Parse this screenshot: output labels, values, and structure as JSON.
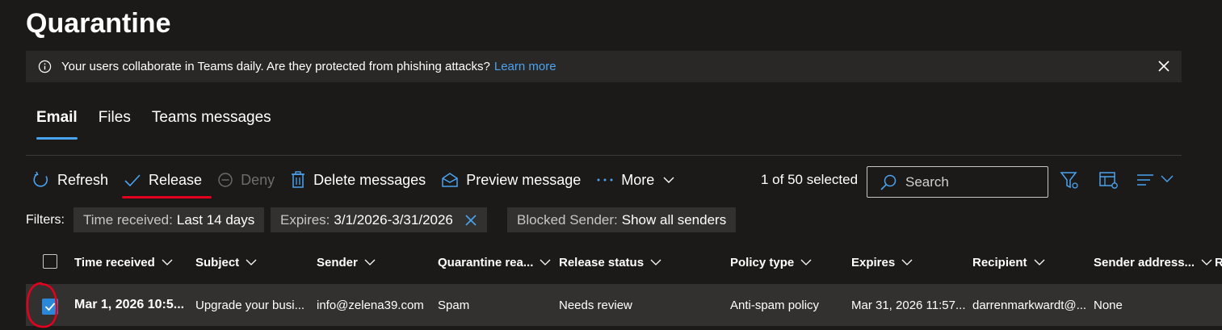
{
  "page": {
    "title": "Quarantine"
  },
  "banner": {
    "text": "Your users collaborate in Teams daily. Are they protected from phishing attacks?",
    "link": "Learn more",
    "icon": "info-icon",
    "close_icon": "close-icon"
  },
  "tabs": [
    {
      "label": "Email",
      "active": true
    },
    {
      "label": "Files",
      "active": false
    },
    {
      "label": "Teams messages",
      "active": false
    }
  ],
  "toolbar": {
    "refresh": "Refresh",
    "release": "Release",
    "deny": "Deny",
    "delete": "Delete messages",
    "preview": "Preview message",
    "more": "More",
    "selected_count": "1 of 50 selected",
    "search_placeholder": "Search"
  },
  "filters": {
    "label": "Filters:",
    "chips": [
      {
        "key": "Time received:",
        "value": "Last 14 days"
      },
      {
        "key": "Expires:",
        "value": "3/1/2026-3/31/2026"
      },
      {
        "key": "Blocked Sender:",
        "value": "Show all senders"
      }
    ]
  },
  "table": {
    "columns": [
      "Time received",
      "Subject",
      "Sender",
      "Quarantine rea...",
      "Release status",
      "Policy type",
      "Expires",
      "Recipient",
      "Sender address...",
      "R"
    ],
    "rows": [
      {
        "selected": true,
        "time_received": "Mar 1, 2026 10:5...",
        "subject": "Upgrade your busi...",
        "sender": "info@zelena39.com",
        "quarantine_reason": "Spam",
        "release_status": "Needs review",
        "policy_type": "Anti-spam policy",
        "expires": "Mar 31, 2026 11:57...",
        "recipient": "darrenmarkwardt@...",
        "sender_address": "None"
      }
    ]
  },
  "colors": {
    "background": "#1b1a19",
    "accent": "#4aa3f0",
    "checkbox_selected": "#2b88d8",
    "annotation_red": "#e5001e"
  }
}
